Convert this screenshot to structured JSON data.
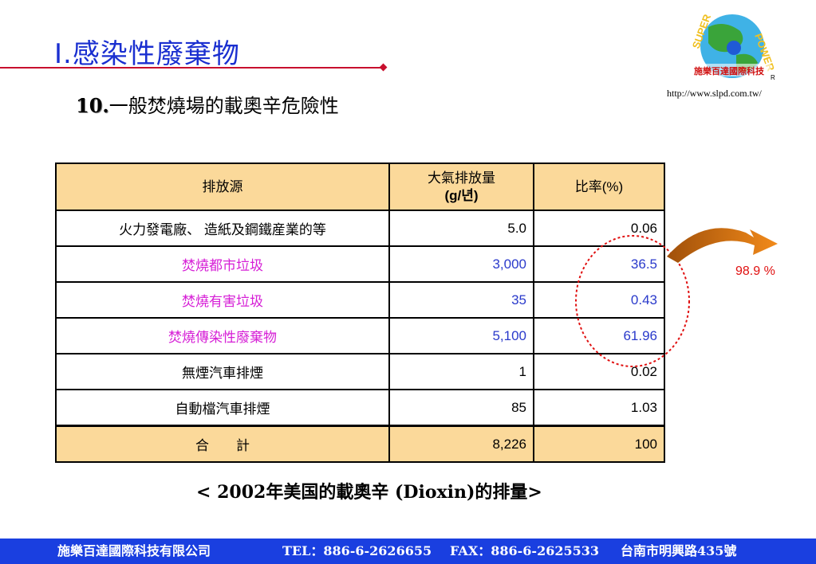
{
  "slide": {
    "title": "Ⅰ.感染性廢棄物",
    "subtitle_num": "10.",
    "subtitle_text": "一般焚燒場的載奧辛危險性",
    "logo_text": "施樂百達國際科技",
    "url": "http://www.slpd.com.tw/"
  },
  "table": {
    "headers": {
      "source": "排放源",
      "emission_line1": "大氣排放量",
      "emission_line2": "(g/년)",
      "ratio": "比率(%)"
    },
    "rows": [
      {
        "source": "火力發電廠、 造紙及鋼鐵産業的等",
        "emission": "5.0",
        "ratio": "0.06"
      },
      {
        "source": "焚燒都市垃圾",
        "emission": "3,000",
        "ratio": "36.5"
      },
      {
        "source": "焚燒有害垃圾",
        "emission": "35",
        "ratio": "0.43"
      },
      {
        "source": "焚燒傳染性廢棄物",
        "emission": "5,100",
        "ratio": "61.96"
      },
      {
        "source": "無煙汽車排煙",
        "emission": "1",
        "ratio": "0.02"
      },
      {
        "source": "自動檔汽車排煙",
        "emission": "85",
        "ratio": "1.03"
      }
    ],
    "total": {
      "label": "合　　計",
      "emission": "8,226",
      "ratio": "100"
    }
  },
  "annotation": {
    "percent": "98.9 %"
  },
  "caption": "< 2002年美国的載奧辛 (Dioxin)的排量>",
  "footer": {
    "company": "施樂百達國際科技有限公司",
    "tel": "TEL：886-6-2626655",
    "fax": "FAX：886-6-2625533",
    "address": "台南市明興路435號"
  },
  "colors": {
    "title": "#1a2fd0",
    "highlight_text": "#d61fd6",
    "value_blue": "#2a3acb",
    "table_header": "#fbd99a",
    "footer_bg": "#1a3fe0",
    "accent_red": "#e01010"
  }
}
